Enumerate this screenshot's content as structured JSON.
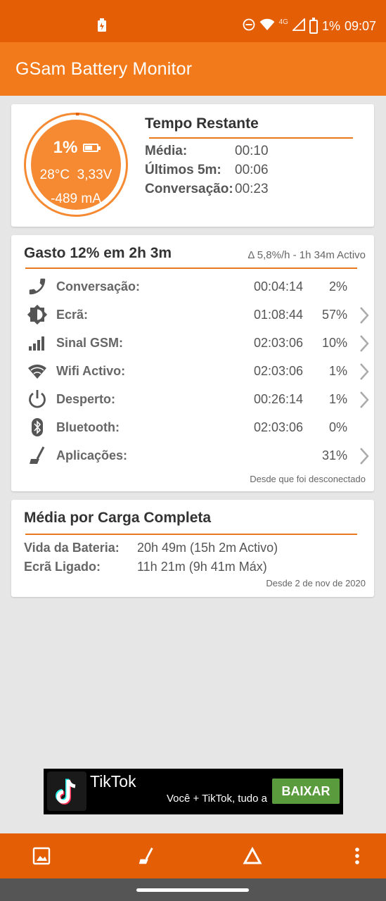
{
  "status_bar": {
    "battery_percent": "1%",
    "network": "4G",
    "time": "09:07",
    "icons": [
      "battery-saver-icon",
      "do-not-disturb-icon",
      "wifi-icon",
      "signal-icon",
      "battery-icon"
    ]
  },
  "app_bar": {
    "title": "GSam Battery Monitor"
  },
  "gauge": {
    "percent": "1%",
    "temperature": "28°C",
    "voltage": "3,33V",
    "current": "-489 mA",
    "level": 0.01,
    "color": "#f58a33"
  },
  "tempo_restante": {
    "title": "Tempo Restante",
    "rows": [
      {
        "label": "Média:",
        "value": "00:10"
      },
      {
        "label": "Últimos 5m:",
        "value": "00:06"
      },
      {
        "label": "Conversação:",
        "value": "00:23"
      }
    ]
  },
  "gasto": {
    "title": "Gasto 12% em 2h 3m",
    "subtitle": "Δ 5,8%/h - 1h 34m Activo",
    "rows": [
      {
        "icon": "phone-icon",
        "label": "Conversação:",
        "time": "00:04:14",
        "percent": "2%",
        "has_chevron": false
      },
      {
        "icon": "screen-brightness-icon",
        "label": "Ecrã:",
        "time": "01:08:44",
        "percent": "57%",
        "has_chevron": true
      },
      {
        "icon": "signal-bars-icon",
        "label": "Sinal GSM:",
        "time": "02:03:06",
        "percent": "10%",
        "has_chevron": true
      },
      {
        "icon": "wifi-icon",
        "label": "Wifi Activo:",
        "time": "02:03:06",
        "percent": "1%",
        "has_chevron": true
      },
      {
        "icon": "power-icon",
        "label": "Desperto:",
        "time": "00:26:14",
        "percent": "1%",
        "has_chevron": true
      },
      {
        "icon": "bluetooth-icon",
        "label": "Bluetooth:",
        "time": "02:03:06",
        "percent": "0%",
        "has_chevron": false
      },
      {
        "icon": "broom-icon",
        "label": "Aplicações:",
        "time": "",
        "percent": "31%",
        "has_chevron": true
      }
    ],
    "footer": "Desde que foi desconectado"
  },
  "media": {
    "title": "Média por Carga Completa",
    "rows": [
      {
        "label": "Vida da Bateria:",
        "value": "20h 49m (15h 2m Activo)"
      },
      {
        "label": "Ecrã Ligado:",
        "value": "11h 21m (9h 41m Máx)"
      }
    ],
    "footer": "Desde 2 de nov de 2020"
  },
  "ad": {
    "title": "TikTok",
    "text": "Você + TikTok, tudo a",
    "button": "BAIXAR"
  },
  "bottom_toolbar": {
    "items": [
      "image-icon",
      "broom-icon",
      "delta-icon",
      "more-vert-icon"
    ]
  },
  "colors": {
    "status_bar": "#e35e05",
    "app_bar": "#f27a1a",
    "accent": "#e8791f",
    "ad_button": "#5a9b3d"
  }
}
